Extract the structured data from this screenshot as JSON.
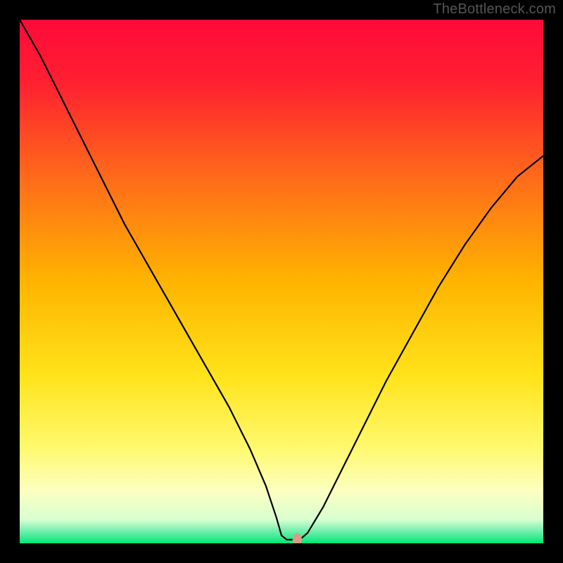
{
  "watermark": "TheBottleneck.com",
  "chart_data": {
    "type": "line",
    "title": "",
    "xlabel": "",
    "ylabel": "",
    "xlim": [
      0,
      100
    ],
    "ylim": [
      0,
      100
    ],
    "background_gradient": {
      "type": "vertical",
      "stops": [
        {
          "pos": 0.0,
          "color": "#ff0a3a"
        },
        {
          "pos": 0.12,
          "color": "#ff2030"
        },
        {
          "pos": 0.3,
          "color": "#ff6a1a"
        },
        {
          "pos": 0.5,
          "color": "#ffb400"
        },
        {
          "pos": 0.68,
          "color": "#ffe31a"
        },
        {
          "pos": 0.82,
          "color": "#fff970"
        },
        {
          "pos": 0.9,
          "color": "#fcffc0"
        },
        {
          "pos": 0.955,
          "color": "#d8ffd0"
        },
        {
          "pos": 0.975,
          "color": "#7af0b0"
        },
        {
          "pos": 1.0,
          "color": "#00e676"
        }
      ]
    },
    "series": [
      {
        "name": "bottleneck-curve",
        "color": "#000000",
        "width": 2.2,
        "x": [
          0,
          4,
          8,
          12,
          16,
          20,
          24,
          28,
          32,
          36,
          40,
          44,
          47,
          49,
          50,
          51,
          52.7,
          53.5,
          55,
          58,
          62,
          66,
          70,
          75,
          80,
          85,
          90,
          95,
          100
        ],
        "y": [
          100,
          93,
          85,
          77,
          69,
          61,
          54,
          47,
          40,
          33,
          26,
          18,
          11,
          5,
          1.5,
          0.7,
          0.7,
          0.7,
          2,
          7,
          15,
          23,
          31,
          40,
          49,
          57,
          64,
          70,
          74
        ]
      }
    ],
    "marker": {
      "name": "optimal-point",
      "x": 53.0,
      "y": 0.7,
      "rx": 0.9,
      "ry": 1.2,
      "color": "#d99a88"
    }
  }
}
